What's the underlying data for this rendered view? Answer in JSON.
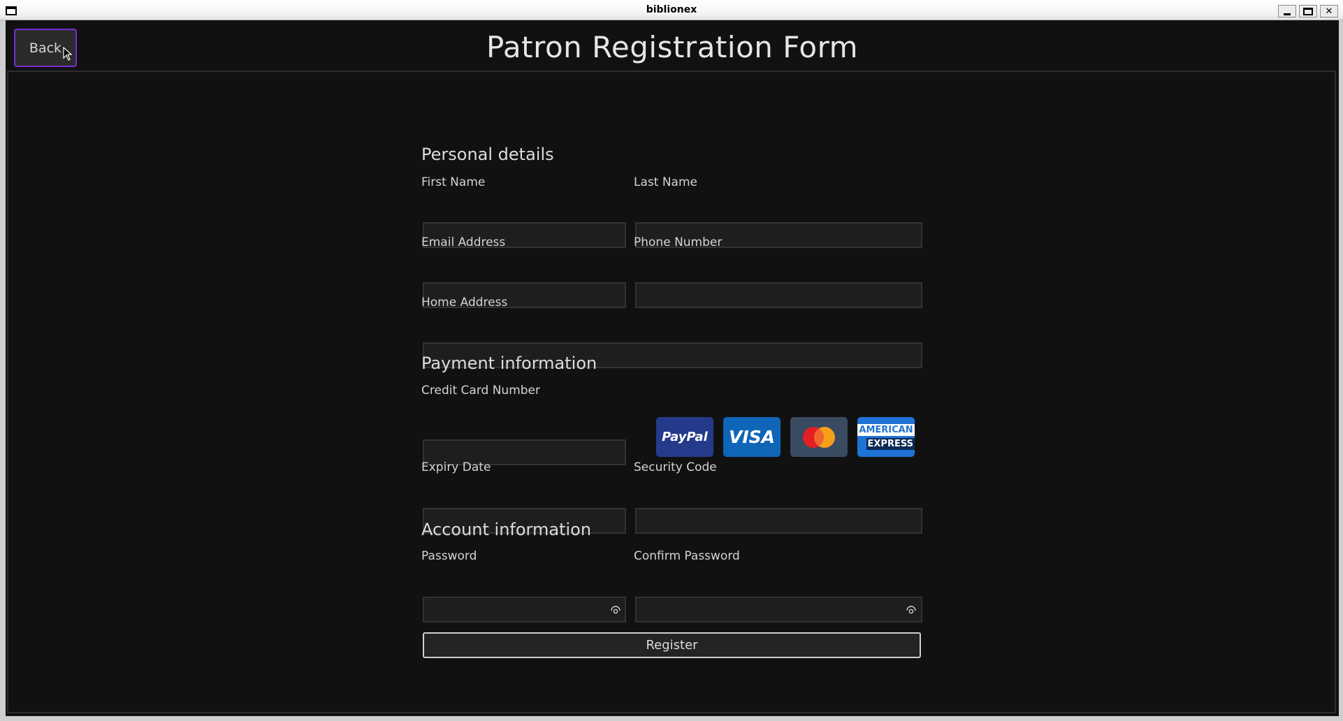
{
  "window": {
    "title": "biblionex",
    "controls": {
      "minimize": "_",
      "maximize": "□",
      "close": "✕"
    }
  },
  "header": {
    "back_label": "Back",
    "title": "Patron Registration Form"
  },
  "sections": {
    "personal": {
      "title": "Personal details",
      "first_name": {
        "label": "First Name",
        "value": ""
      },
      "last_name": {
        "label": "Last Name",
        "value": ""
      },
      "email": {
        "label": "Email Address",
        "value": ""
      },
      "phone": {
        "label": "Phone Number",
        "value": ""
      },
      "address": {
        "label": "Home Address",
        "value": ""
      }
    },
    "payment": {
      "title": "Payment information",
      "card_number": {
        "label": "Credit Card Number",
        "value": ""
      },
      "expiry": {
        "label": "Expiry Date",
        "value": ""
      },
      "security_code": {
        "label": "Security Code",
        "value": ""
      },
      "card_brands": {
        "paypal": "PayPal",
        "visa": "VISA",
        "mastercard": "Mastercard",
        "amex_line1": "AMERICAN",
        "amex_line2": "EXPRESS"
      }
    },
    "account": {
      "title": "Account information",
      "password": {
        "label": "Password",
        "value": ""
      },
      "confirm_password": {
        "label": "Confirm Password",
        "value": ""
      }
    }
  },
  "register_label": "Register",
  "colors": {
    "background": "#111111",
    "back_button_border": "#7a2fd0",
    "paypal": "#253a8a",
    "visa": "#0f66b8",
    "mastercard_bg": "#3a4a60",
    "mastercard_red": "#e31e24",
    "mastercard_orange": "#f79e1b",
    "amex": "#1f73d6"
  }
}
